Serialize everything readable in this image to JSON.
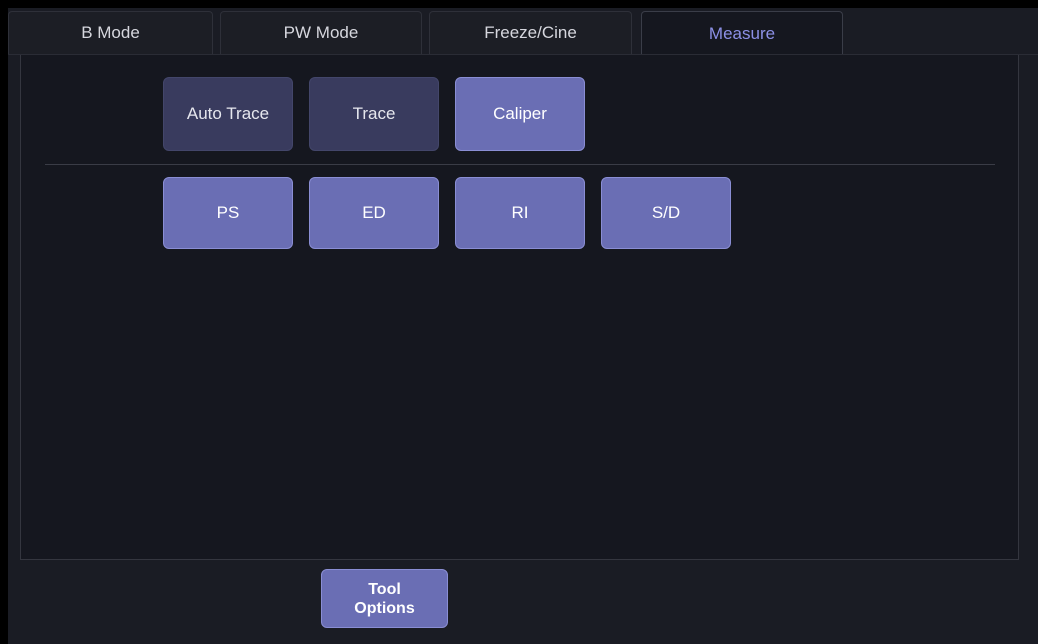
{
  "tabs": [
    {
      "label": "B Mode",
      "active": false
    },
    {
      "label": "PW Mode",
      "active": false
    },
    {
      "label": "Freeze/Cine",
      "active": false
    },
    {
      "label": "Measure",
      "active": true
    }
  ],
  "tools": {
    "auto_trace": "Auto Trace",
    "trace": "Trace",
    "caliper": "Caliper"
  },
  "measurements": {
    "ps": "PS",
    "ed": "ED",
    "ri": "RI",
    "sd": "S/D"
  },
  "footer": {
    "tool_options_line1": "Tool",
    "tool_options_line2": "Options"
  },
  "colors": {
    "background": "#15171f",
    "active_tab_text": "#8c90e6",
    "button_active": "#6a6eb4",
    "button_inactive": "#393b5e"
  }
}
